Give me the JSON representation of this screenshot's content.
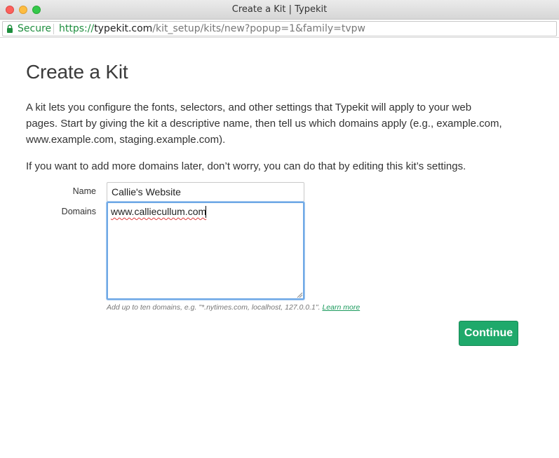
{
  "window": {
    "title": "Create a Kit | Typekit"
  },
  "address_bar": {
    "secure_label": "Secure",
    "url_scheme": "https://",
    "url_host": "typekit.com",
    "url_path": "/kit_setup/kits/new?popup=1&family=tvpw"
  },
  "page": {
    "title": "Create a Kit",
    "intro": "A kit lets you configure the fonts, selectors, and other settings that Typekit will apply to your web pages. Start by giving the kit a descriptive name, then tell us which domains apply (e.g., example.com, www.example.com, staging.example.com).",
    "intro2": "If you want to add more domains later, don’t worry, you can do that by editing this kit’s settings."
  },
  "form": {
    "name_label": "Name",
    "name_value": "Callie's Website",
    "domains_label": "Domains",
    "domains_value": "www.calliecullum.com",
    "hint": "Add up to ten domains, e.g. \"*.nytimes.com, localhost, 127.0.0.1\". ",
    "learn_more": "Learn more",
    "continue_label": "Continue"
  },
  "colors": {
    "accent": "#1fa96b",
    "secure_green": "#1e8e3e",
    "focus_blue": "#6ea8e6"
  },
  "icons": {
    "lock": "lock-icon",
    "close": "close-icon",
    "minimize": "minimize-icon",
    "zoom": "zoom-icon",
    "resize": "resize-grip-icon"
  }
}
